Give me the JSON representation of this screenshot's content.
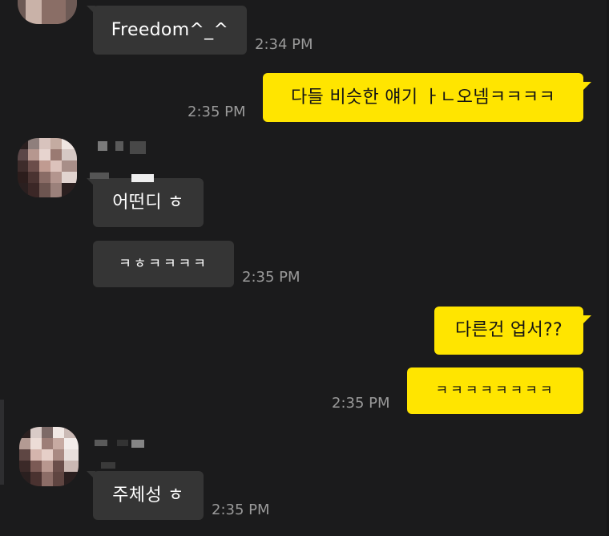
{
  "messages": {
    "m1": {
      "text": "Freedom^_^",
      "time": "2:34 PM"
    },
    "m2": {
      "text": "다들 비슷한 얘기 ㅏㄴ오넴ㅋㅋㅋㅋ",
      "time": "2:35 PM"
    },
    "m3": {
      "text": "어떤디 ㅎ"
    },
    "m4": {
      "text": "ㅋㅎㅋㅋㅋㅋ",
      "time": "2:35 PM"
    },
    "m5": {
      "text": "다른건 업서??"
    },
    "m6": {
      "text": "ㅋㅋㅋㅋㅋㅋㅋㅋ",
      "time": "2:35 PM"
    },
    "m7": {
      "text": "주체성 ㅎ",
      "time": "2:35 PM"
    }
  },
  "colors": {
    "background": "#1b1b1c",
    "incoming_bubble": "#353535",
    "outgoing_bubble": "#ffe500",
    "timestamp": "#9a9a9a"
  }
}
